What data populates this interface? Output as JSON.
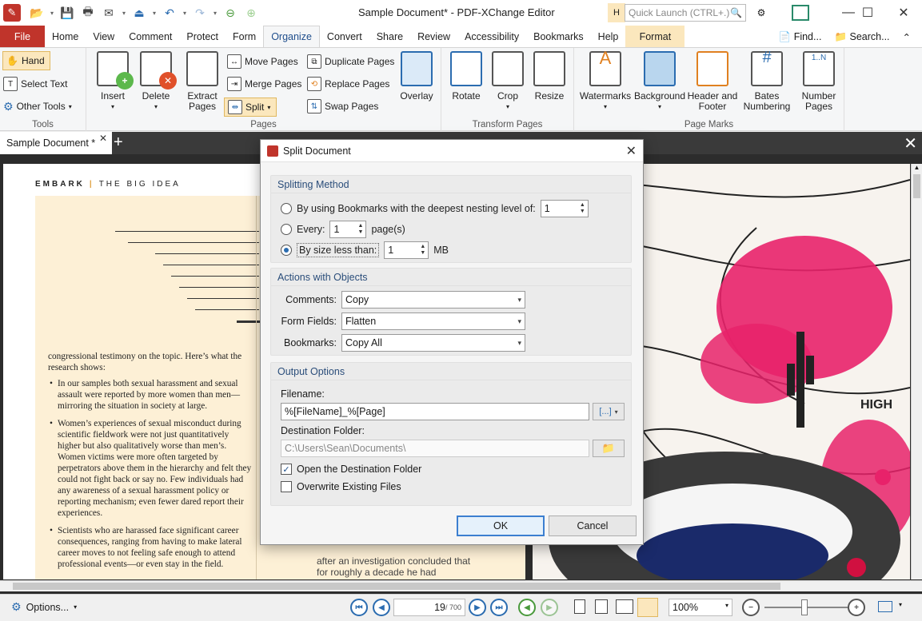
{
  "window": {
    "title": "Sample Document* - PDF-XChange Editor",
    "help_letter": "H",
    "quick_launch_placeholder": "Quick Launch (CTRL+.)"
  },
  "tabs": {
    "file": "File",
    "items": [
      "Home",
      "View",
      "Comment",
      "Protect",
      "Form",
      "Organize",
      "Convert",
      "Share",
      "Review",
      "Accessibility",
      "Bookmarks",
      "Help"
    ],
    "active": "Organize",
    "format": "Format",
    "find": "Find...",
    "search": "Search..."
  },
  "ribbon": {
    "tools": {
      "hand": "Hand",
      "select_text": "Select Text",
      "other_tools": "Other Tools",
      "label": "Tools"
    },
    "pages": {
      "insert": "Insert",
      "delete": "Delete",
      "extract": "Extract Pages",
      "move": "Move Pages",
      "merge": "Merge Pages",
      "split": "Split",
      "duplicate": "Duplicate Pages",
      "replace": "Replace Pages",
      "swap": "Swap Pages",
      "overlay": "Overlay",
      "label": "Pages"
    },
    "transform": {
      "rotate": "Rotate",
      "crop": "Crop",
      "resize": "Resize",
      "label": "Transform Pages"
    },
    "marks": {
      "watermarks": "Watermarks",
      "background": "Background",
      "header_footer": "Header and Footer",
      "bates": "Bates Numbering",
      "number_pages": "Number Pages",
      "label": "Page Marks"
    }
  },
  "document_tab": {
    "name": "Sample Document *"
  },
  "page": {
    "embark": "EMBARK",
    "big_idea": "THE BIG IDEA",
    "intro": "congressional testimony on the topic. Here’s what the research shows:",
    "bullets": [
      "In our samples both sexual harassment and sexual assault were reported by more women than men—mirroring the situation in society at large.",
      "Women’s experiences of sexual misconduct during scientific fieldwork were not just quantitatively higher but also qualitatively worse than men’s. Women victims were more often targeted by perpetrators above them in the hierarchy and felt they could not fight back or say no. Few individuals had any awareness of a sexual harassment policy or reporting mechanism; even fewer dared report their experiences.",
      "Scientists who are harassed face significant career consequences, ranging from having to make lateral career moves to not feeling safe enough to attend professional events—or even stay in the field."
    ],
    "col2": "after an investigation concluded that for roughly a decade he had subjected students to unwanted",
    "art_text": "HIGH"
  },
  "dialog": {
    "title": "Split Document",
    "splitting_method": {
      "header": "Splitting Method",
      "bookmarks_label": "By using Bookmarks with the deepest nesting level of:",
      "bookmarks_value": "1",
      "every_label": "Every:",
      "every_value": "1",
      "every_unit": "page(s)",
      "size_label": "By size less than:",
      "size_value": "1",
      "size_unit": "MB",
      "selected": "size"
    },
    "actions": {
      "header": "Actions with Objects",
      "comments_label": "Comments:",
      "comments_value": "Copy",
      "form_fields_label": "Form Fields:",
      "form_fields_value": "Flatten",
      "bookmarks_label": "Bookmarks:",
      "bookmarks_value": "Copy All"
    },
    "output": {
      "header": "Output Options",
      "filename_label": "Filename:",
      "filename_value": "%[FileName]_%[Page]",
      "macro_btn": "[...]",
      "dest_label": "Destination Folder:",
      "dest_value": "C:\\Users\\Sean\\Documents\\",
      "open_dest": "Open the Destination Folder",
      "open_dest_checked": true,
      "overwrite": "Overwrite Existing Files",
      "overwrite_checked": false
    },
    "ok": "OK",
    "cancel": "Cancel"
  },
  "statusbar": {
    "options": "Options...",
    "page_current": "19",
    "page_total": "/ 700",
    "zoom": "100%"
  },
  "colors": {
    "file_tab": "#c0342b",
    "accent_highlight": "#fbe7bd",
    "link_blue": "#2b6cb0",
    "section_header": "#2a4d7a"
  }
}
